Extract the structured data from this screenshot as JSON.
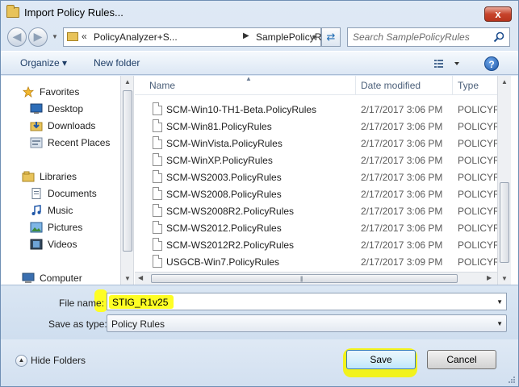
{
  "window": {
    "title": "Import Policy Rules...",
    "close_glyph": "x"
  },
  "address": {
    "segment1": "PolicyAnalyzer+S...",
    "segment2": "SamplePolicyRules",
    "overflow": "«"
  },
  "search": {
    "placeholder": "Search SamplePolicyRules"
  },
  "toolbar": {
    "organize": "Organize ▾",
    "new_folder": "New folder",
    "help": "?"
  },
  "navpane": {
    "items": [
      {
        "label": "Favorites",
        "icon": "star-icon"
      },
      {
        "label": "Desktop",
        "icon": "desktop-icon"
      },
      {
        "label": "Downloads",
        "icon": "downloads-icon"
      },
      {
        "label": "Recent Places",
        "icon": "recent-places-icon"
      },
      {
        "label": "Libraries",
        "icon": "libraries-icon"
      },
      {
        "label": "Documents",
        "icon": "documents-icon"
      },
      {
        "label": "Music",
        "icon": "music-icon"
      },
      {
        "label": "Pictures",
        "icon": "pictures-icon"
      },
      {
        "label": "Videos",
        "icon": "videos-icon"
      },
      {
        "label": "Computer",
        "icon": "computer-icon"
      }
    ]
  },
  "files": {
    "columns": {
      "name": "Name",
      "date": "Date modified",
      "type": "Type"
    },
    "rows": [
      {
        "name": "SCM-Win10-TH1-Beta.PolicyRules",
        "date": "2/17/2017 3:06 PM",
        "type": "POLICYRU"
      },
      {
        "name": "SCM-Win81.PolicyRules",
        "date": "2/17/2017 3:06 PM",
        "type": "POLICYRU"
      },
      {
        "name": "SCM-WinVista.PolicyRules",
        "date": "2/17/2017 3:06 PM",
        "type": "POLICYRU"
      },
      {
        "name": "SCM-WinXP.PolicyRules",
        "date": "2/17/2017 3:06 PM",
        "type": "POLICYRU"
      },
      {
        "name": "SCM-WS2003.PolicyRules",
        "date": "2/17/2017 3:06 PM",
        "type": "POLICYRU"
      },
      {
        "name": "SCM-WS2008.PolicyRules",
        "date": "2/17/2017 3:06 PM",
        "type": "POLICYRU"
      },
      {
        "name": "SCM-WS2008R2.PolicyRules",
        "date": "2/17/2017 3:06 PM",
        "type": "POLICYRU"
      },
      {
        "name": "SCM-WS2012.PolicyRules",
        "date": "2/17/2017 3:06 PM",
        "type": "POLICYRU"
      },
      {
        "name": "SCM-WS2012R2.PolicyRules",
        "date": "2/17/2017 3:06 PM",
        "type": "POLICYRU"
      },
      {
        "name": "USGCB-Win7.PolicyRules",
        "date": "2/17/2017 3:09 PM",
        "type": "POLICYRU"
      }
    ]
  },
  "form": {
    "filename_label": "File name:",
    "filename_value": "STIG_R1v25",
    "savetype_label": "Save as type:",
    "savetype_value": "Policy Rules"
  },
  "footer": {
    "hide_folders": "Hide Folders",
    "save": "Save",
    "cancel": "Cancel"
  },
  "colors": {
    "highlight": "#fefe24",
    "accent": "#1f6bb3"
  }
}
